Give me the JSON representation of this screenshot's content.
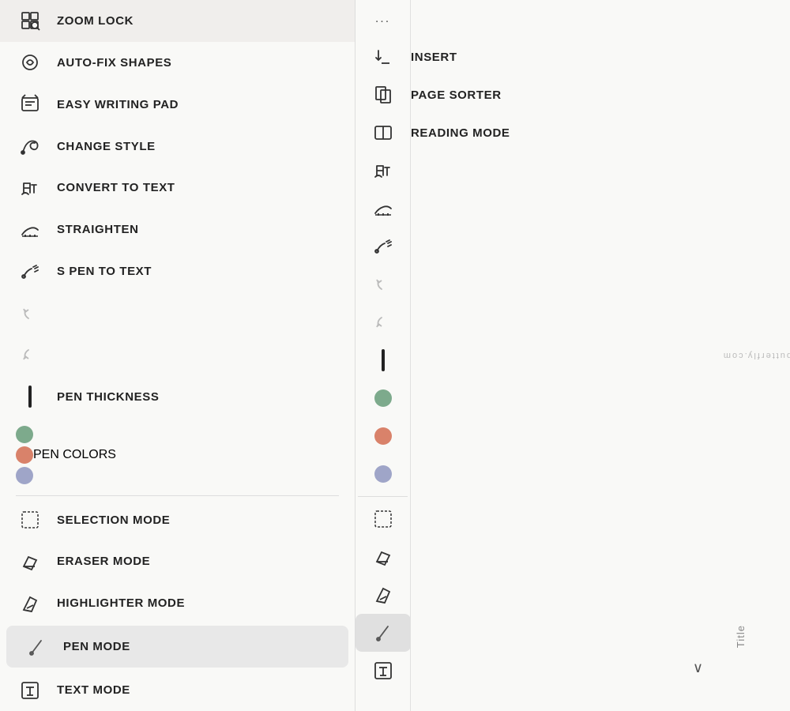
{
  "left_panel": {
    "items": [
      {
        "id": "zoom-lock",
        "label": "ZOOM LOCK",
        "icon": "zoom-lock-icon"
      },
      {
        "id": "auto-fix-shapes",
        "label": "AUTO-FIX SHAPES",
        "icon": "auto-fix-icon"
      },
      {
        "id": "easy-writing-pad",
        "label": "EASY WRITING PAD",
        "icon": "writing-pad-icon"
      },
      {
        "id": "change-style",
        "label": "CHANGE STYLE",
        "icon": "change-style-icon"
      },
      {
        "id": "convert-to-text",
        "label": "CONVERT TO TEXT",
        "icon": "convert-text-icon"
      },
      {
        "id": "straighten",
        "label": "STRAIGHTEN",
        "icon": "straighten-icon"
      },
      {
        "id": "s-pen-to-text",
        "label": "S PEN TO TEXT",
        "icon": "s-pen-icon"
      }
    ],
    "extra_items": [
      {
        "id": "pen-thickness",
        "label": "PEN THICKNESS",
        "icon": "pen-thickness-icon"
      },
      {
        "id": "pen-colors",
        "label": "PEN COLORS",
        "icon": "pen-colors-icon"
      },
      {
        "id": "selection-mode",
        "label": "SELECTION MODE",
        "icon": "selection-icon"
      },
      {
        "id": "eraser-mode",
        "label": "ERASER MODE",
        "icon": "eraser-icon"
      },
      {
        "id": "highlighter-mode",
        "label": "HIGHLIGHTER MODE",
        "icon": "highlighter-icon"
      },
      {
        "id": "pen-mode",
        "label": "PEN MODE",
        "icon": "pen-mode-icon"
      },
      {
        "id": "text-mode",
        "label": "TEXT MODE",
        "icon": "text-mode-icon"
      }
    ],
    "colors": [
      "#7daa8c",
      "#d9826a",
      "#9fa5c8"
    ]
  },
  "right_panel": {
    "top_items": [
      {
        "id": "insert",
        "label": "INSERT",
        "icon": "insert-icon"
      },
      {
        "id": "page-sorter",
        "label": "PAGE SORTER",
        "icon": "page-sorter-icon"
      },
      {
        "id": "reading-mode",
        "label": "READING MODE",
        "icon": "reading-mode-icon"
      }
    ],
    "dots": "...",
    "icons_col": [
      {
        "id": "r-convert-text",
        "icon": "convert-text-icon"
      },
      {
        "id": "r-straighten",
        "icon": "straighten-icon"
      },
      {
        "id": "r-s-pen",
        "icon": "s-pen-icon"
      },
      {
        "id": "r-undo1",
        "icon": "undo1-icon"
      },
      {
        "id": "r-undo2",
        "icon": "undo2-icon"
      },
      {
        "id": "r-pen-thickness",
        "icon": "pen-thickness-icon"
      }
    ],
    "colors": [
      "#7daa8c",
      "#d9826a",
      "#9fa5c8"
    ],
    "bottom_icons": [
      {
        "id": "r-selection",
        "icon": "selection-icon"
      },
      {
        "id": "r-eraser",
        "icon": "eraser-icon"
      },
      {
        "id": "r-highlighter",
        "icon": "highlighter-icon"
      },
      {
        "id": "r-pen-mode",
        "icon": "pen-mode-icon",
        "active": true
      },
      {
        "id": "r-text-mode",
        "icon": "text-mode-icon"
      }
    ],
    "title_tab": "Title",
    "chevron": "∨",
    "watermark": "honeynbutterfly.com"
  }
}
